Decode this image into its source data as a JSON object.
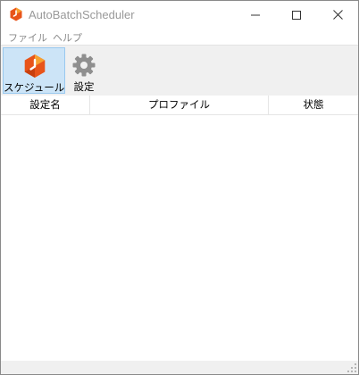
{
  "window": {
    "title": "AutoBatchScheduler",
    "app_icon": "hexagon-clock-icon",
    "accent_color": "#e8541a"
  },
  "menu": {
    "file": "ファイル",
    "help": "ヘルプ"
  },
  "toolbar": {
    "schedule_label": "スケジュール",
    "schedule_icon": "schedule-clock-icon",
    "settings_label": "設定",
    "settings_icon": "gear-icon"
  },
  "list": {
    "columns": [
      "設定名",
      "プロファイル",
      "状態"
    ],
    "rows": []
  }
}
